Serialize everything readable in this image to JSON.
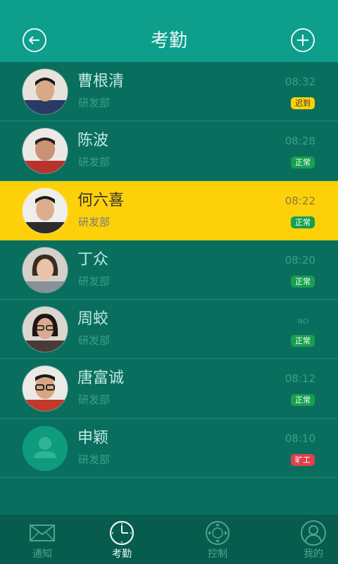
{
  "header": {
    "title": "考勤"
  },
  "rows": [
    {
      "name": "曹根清",
      "dept": "研发部",
      "time": "08:32",
      "status": "迟到"
    },
    {
      "name": "陈波",
      "dept": "研发部",
      "time": "08:28",
      "status": "正常"
    },
    {
      "name": "何六喜",
      "dept": "研发部",
      "time": "08:22",
      "status": "正常"
    },
    {
      "name": "丁众",
      "dept": "研发部",
      "time": "08:20",
      "status": "正常"
    },
    {
      "name": "周蛟",
      "dept": "研发部",
      "time": "NO",
      "status": "正常"
    },
    {
      "name": "唐富诚",
      "dept": "研发部",
      "time": "08:12",
      "status": "正常"
    },
    {
      "name": "申颖",
      "dept": "研发部",
      "time": "08:10",
      "status": "旷工"
    }
  ],
  "tabs": [
    {
      "label": "通知",
      "icon": "envelope-icon"
    },
    {
      "label": "考勤",
      "icon": "clock-icon"
    },
    {
      "label": "控制",
      "icon": "dpad-icon"
    },
    {
      "label": "我的",
      "icon": "user-icon"
    }
  ],
  "colors": {
    "header_bg": "#0d9e8c",
    "list_bg": "#0a6e5e",
    "highlight_row": "#fdd10a",
    "badge_late": "#fdd10a",
    "badge_normal": "#17a04f",
    "badge_absent": "#e0404e",
    "tabbar_bg": "#075c4e"
  }
}
